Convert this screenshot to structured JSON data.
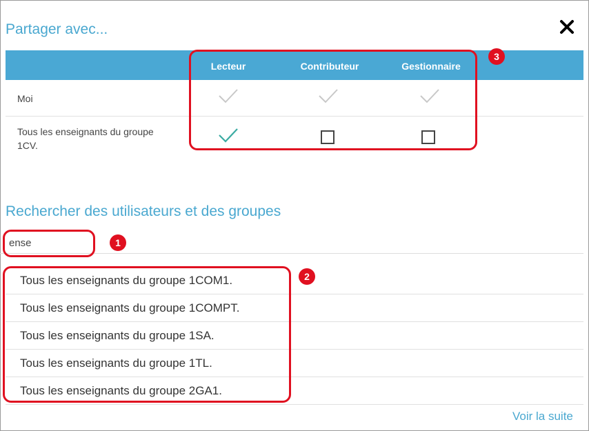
{
  "dialog": {
    "title": "Partager avec...",
    "close_icon": "close-icon"
  },
  "share_table": {
    "columns": [
      "Lecteur",
      "Contributeur",
      "Gestionnaire"
    ],
    "rows": [
      {
        "label": "Moi",
        "states": [
          "disabled-check",
          "disabled-check",
          "disabled-check"
        ]
      },
      {
        "label": "Tous les enseignants du groupe 1CV.",
        "states": [
          "checked",
          "unchecked",
          "unchecked"
        ]
      }
    ]
  },
  "search": {
    "title": "Rechercher des utilisateurs et des groupes",
    "value": "ense"
  },
  "results": [
    "Tous les enseignants du groupe 1COM1.",
    "Tous les enseignants du groupe 1COMPT.",
    "Tous les enseignants du groupe 1SA.",
    "Tous les enseignants du groupe 1TL.",
    "Tous les enseignants du groupe 2GA1."
  ],
  "more_link": "Voir la suite",
  "annotations": [
    "1",
    "2",
    "3"
  ],
  "colors": {
    "accent": "#4aa8d4",
    "annotation": "#e01020",
    "check_active": "#3aaba2",
    "check_disabled": "#c8c8c8"
  }
}
